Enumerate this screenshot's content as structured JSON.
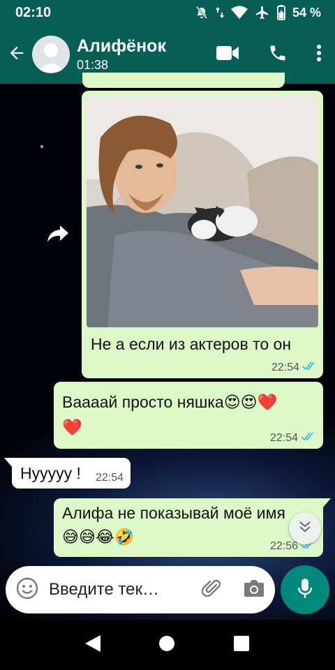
{
  "status_bar": {
    "time": "02:10",
    "battery": "54 %"
  },
  "header": {
    "contact_name": "Алифёнок",
    "contact_status": "01:38"
  },
  "messages": [
    {
      "direction": "out",
      "has_photo": true,
      "text": "Не а если из актеров то он",
      "time": "22:54",
      "read": true
    },
    {
      "direction": "out",
      "text_line1": "Ваааай просто няшка😍😍❤️",
      "text_line2": "❤️",
      "time": "22:54",
      "read": true
    },
    {
      "direction": "in",
      "text": "Нууууу !",
      "time": "22:54"
    },
    {
      "direction": "out",
      "text_line1": "Алифа не показывай моё имя",
      "text_line2": "😅😅😂🤣",
      "time": "22:56",
      "read": true
    }
  ],
  "input": {
    "placeholder": "Введите тек…"
  },
  "colors": {
    "header": "#075e54",
    "outgoing_bubble": "#dcf8c6",
    "incoming_bubble": "#ffffff",
    "mic_button": "#00897b",
    "read_ticks": "#34b7f1"
  }
}
